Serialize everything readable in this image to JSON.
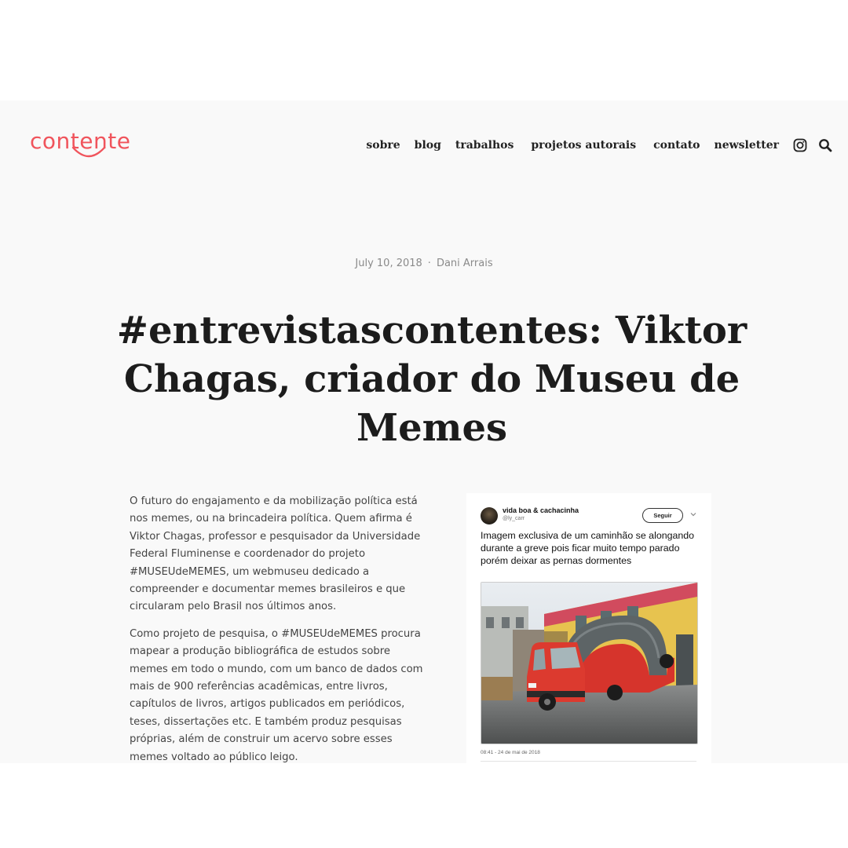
{
  "brand": {
    "logo_text": "contente",
    "color": "#f0545c"
  },
  "nav": {
    "items": [
      "sobre",
      "blog",
      "trabalhos",
      "projetos autorais",
      "contato",
      "newsletter"
    ],
    "icons": [
      "instagram-icon",
      "search-icon"
    ]
  },
  "post": {
    "date": "July 10, 2018",
    "separator": "·",
    "author": "Dani Arrais",
    "title": "#entrevistascontentes: Viktor Chagas, criador do Museu de Memes",
    "paragraphs": [
      "O futuro do engajamento e da mobilização política está nos memes, ou na brincadeira política. Quem afirma é Viktor Chagas, professor e pesquisador da Universidade Federal Fluminense e coordenador do projeto #MUSEUdeMEMES, um webmuseu dedicado a compreender e documentar memes brasileiros e que circularam pelo Brasil nos últimos anos.",
      "Como projeto de pesquisa, o #MUSEUdeMEMES procura mapear a produção bibliográfica de estudos sobre memes em todo o mundo, com um banco de dados com mais de 900 referências acadêmicas, entre livros, capítulos de livros, artigos publicados em periódicos, teses, dissertações etc. E também produz pesquisas próprias, além de construir um acervo sobre esses memes voltado ao público leigo."
    ]
  },
  "tweet": {
    "name": "vida boa & cachacinha",
    "handle": "@ly_carr",
    "follow_label": "Seguir",
    "text": "Imagem exclusiva de um caminhão se alongando durante a greve pois ficar muito tempo parado porém deixar as pernas dormentes",
    "timestamp": "08:41 - 24 de mai de 2018"
  }
}
